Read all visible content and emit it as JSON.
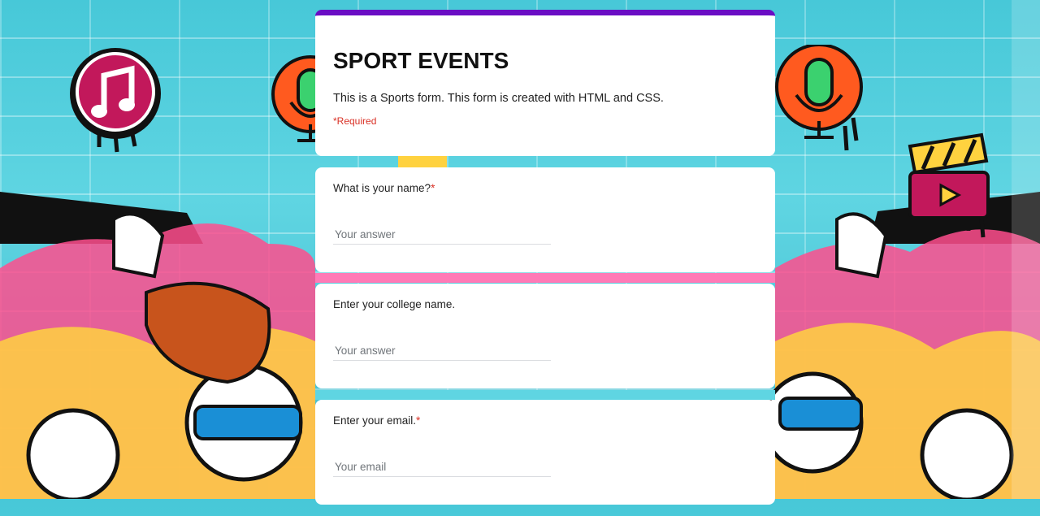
{
  "form": {
    "title": "SPORT EVENTS",
    "description": "This is a Sports form. This form is created with HTML and CSS.",
    "required_note": "*Required",
    "accent_color": "#6a0dc4"
  },
  "questions": [
    {
      "label": "What is your name?",
      "required_mark": "*",
      "placeholder": "Your answer"
    },
    {
      "label": "Enter your college name.",
      "required_mark": "",
      "placeholder": "Your answer"
    },
    {
      "label": "Enter your email.",
      "required_mark": "*",
      "placeholder": "Your email"
    }
  ],
  "background": {
    "theme": "graffiti brick wall",
    "icons": [
      "music-note-icon",
      "microphone-icon",
      "clapperboard-icon"
    ],
    "colors": {
      "wall": "#5fd5e2",
      "pink": "#c2185b",
      "orange": "#ff5a1f",
      "green": "#3bd16f",
      "yellow": "#ffd23f"
    }
  }
}
